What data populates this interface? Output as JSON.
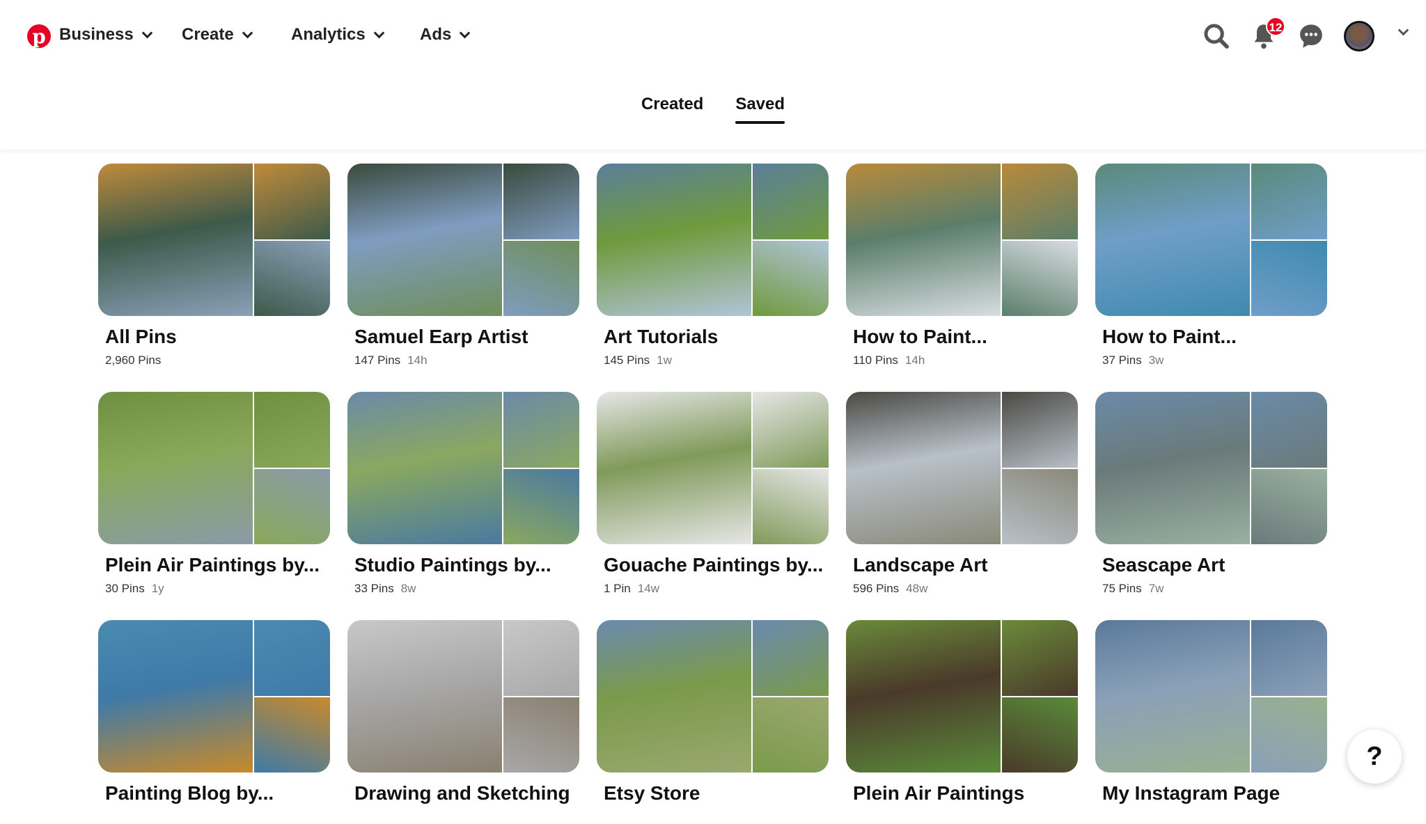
{
  "header": {
    "logo": "Pinterest",
    "nav": [
      {
        "label": "Business"
      },
      {
        "label": "Create"
      },
      {
        "label": "Analytics"
      },
      {
        "label": "Ads"
      }
    ],
    "notification_count": "12",
    "brand_color": "#e60023"
  },
  "tabs": [
    {
      "label": "Created",
      "active": false
    },
    {
      "label": "Saved",
      "active": true
    }
  ],
  "boards": [
    {
      "title": "All Pins",
      "pins": "2,960 Pins",
      "updated": "",
      "colors": [
        "#3d5a4a",
        "#c08a3a",
        "#8aa0b8"
      ]
    },
    {
      "title": "Samuel Earp Artist",
      "pins": "147 Pins",
      "updated": "14h",
      "colors": [
        "#7f9cc0",
        "#3a4a3c",
        "#6f8f5a"
      ]
    },
    {
      "title": "Art Tutorials",
      "pins": "145 Pins",
      "updated": "1w",
      "colors": [
        "#6f9a3c",
        "#5a7f9a",
        "#b0c4d8"
      ]
    },
    {
      "title": "How to Paint...",
      "pins": "110 Pins",
      "updated": "14h",
      "colors": [
        "#5b7e6a",
        "#b88a3a",
        "#d8dde2"
      ]
    },
    {
      "title": "How to Paint...",
      "pins": "37 Pins",
      "updated": "3w",
      "colors": [
        "#6f9ec8",
        "#5a8a7a",
        "#3f8ab0"
      ]
    },
    {
      "title": "Plein Air Paintings by...",
      "pins": "30 Pins",
      "updated": "1y",
      "colors": [
        "#8aa85a",
        "#6f9040",
        "#8a9aa8"
      ]
    },
    {
      "title": "Studio Paintings by...",
      "pins": "33 Pins",
      "updated": "8w",
      "colors": [
        "#8aa860",
        "#6a8aa8",
        "#4a7aa0"
      ]
    },
    {
      "title": "Gouache Paintings by...",
      "pins": "1 Pin",
      "updated": "14w",
      "colors": [
        "#7f9a5a",
        "#e6e6e6",
        "#e6e6e6"
      ]
    },
    {
      "title": "Landscape Art",
      "pins": "596 Pins",
      "updated": "48w",
      "colors": [
        "#b8c0c8",
        "#4a4a44",
        "#8a8a7a"
      ]
    },
    {
      "title": "Seascape Art",
      "pins": "75 Pins",
      "updated": "7w",
      "colors": [
        "#6a7a7a",
        "#6a8aa8",
        "#9ab0a0"
      ]
    },
    {
      "title": "Painting Blog by...",
      "pins": "",
      "updated": "",
      "colors": [
        "#3f7aa8",
        "#4a8ab0",
        "#c88a2a"
      ]
    },
    {
      "title": "Drawing and Sketching",
      "pins": "",
      "updated": "",
      "colors": [
        "#a8a8a8",
        "#c8c8c8",
        "#8a8070"
      ]
    },
    {
      "title": "Etsy Store",
      "pins": "",
      "updated": "",
      "colors": [
        "#7a9a4a",
        "#6a8ab0",
        "#9aa870"
      ]
    },
    {
      "title": "Plein Air Paintings",
      "pins": "",
      "updated": "",
      "colors": [
        "#4a3a2a",
        "#6a8a3a",
        "#5a8a3a"
      ]
    },
    {
      "title": "My Instagram Page",
      "pins": "",
      "updated": "",
      "colors": [
        "#8aa0b8",
        "#5a7a9a",
        "#9ab090"
      ]
    }
  ],
  "help": "?"
}
